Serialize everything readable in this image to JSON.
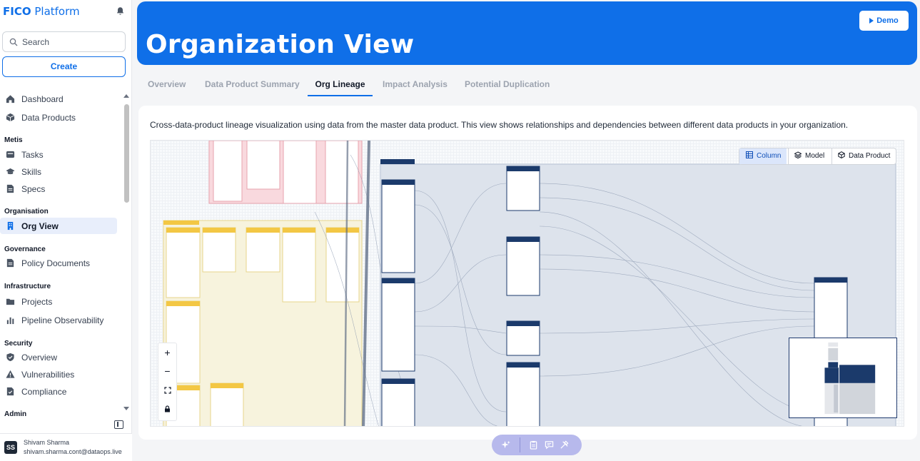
{
  "brand": {
    "bold": "FICO",
    "rest": " Platform"
  },
  "search": {
    "placeholder": "Search"
  },
  "create_label": "Create",
  "nav": {
    "dashboard": "Dashboard",
    "data_products": "Data Products",
    "metis_section": "Metis",
    "tasks": "Tasks",
    "skills": "Skills",
    "specs": "Specs",
    "organisation_section": "Organisation",
    "org_view": "Org View",
    "governance_section": "Governance",
    "policy_documents": "Policy Documents",
    "infrastructure_section": "Infrastructure",
    "projects": "Projects",
    "pipeline_observability": "Pipeline Observability",
    "security_section": "Security",
    "overview": "Overview",
    "vulnerabilities": "Vulnerabilities",
    "compliance": "Compliance",
    "admin_section": "Admin"
  },
  "user": {
    "initials": "SS",
    "name": "Shivam Sharma",
    "email": "shivam.sharma.cont@dataops.live"
  },
  "header": {
    "title": "Organization View",
    "demo_label": "Demo"
  },
  "tabs": [
    "Overview",
    "Data Product Summary",
    "Org Lineage",
    "Impact Analysis",
    "Potential Duplication"
  ],
  "active_tab": "Org Lineage",
  "description": "Cross-data-product lineage visualization using data from the master data product. This view shows relationships and dependencies between different data products in your organization.",
  "view_toggle": {
    "column": "Column",
    "model": "Model",
    "data_product": "Data Product",
    "selected": "Column"
  },
  "zoom": {
    "in": "+",
    "out": "−"
  },
  "colors": {
    "brand": "#0f6fe8",
    "node_header": "#1b3a6b",
    "yellow_group": "#f3c744",
    "pink_group": "#f5c5cc",
    "fab": "#b7b9ec"
  }
}
